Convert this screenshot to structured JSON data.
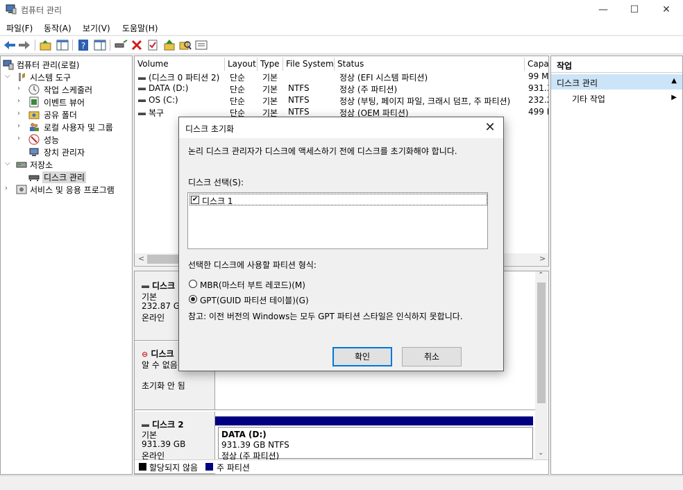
{
  "window": {
    "title": "컴퓨터 관리",
    "minimize": "—",
    "maximize": "☐",
    "close": "✕"
  },
  "menu": [
    "파일(F)",
    "동작(A)",
    "보기(V)",
    "도움말(H)"
  ],
  "tree": {
    "items": [
      {
        "label": "컴퓨터 관리(로컬)",
        "icon": "computer-management-icon"
      },
      {
        "label": "시스템 도구",
        "icon": "tools-icon"
      },
      {
        "label": "작업 스케줄러",
        "icon": "clock-icon"
      },
      {
        "label": "이벤트 뷰어",
        "icon": "event-viewer-icon"
      },
      {
        "label": "공유 폴더",
        "icon": "shared-folder-icon"
      },
      {
        "label": "로컬 사용자 및 그룹",
        "icon": "users-icon"
      },
      {
        "label": "성능",
        "icon": "performance-icon"
      },
      {
        "label": "장치 관리자",
        "icon": "device-manager-icon"
      },
      {
        "label": "저장소",
        "icon": "storage-icon"
      },
      {
        "label": "디스크 관리",
        "icon": "disk-management-icon"
      },
      {
        "label": "서비스 및 응용 프로그램",
        "icon": "services-icon"
      }
    ]
  },
  "volumes": {
    "headers": [
      "Volume",
      "Layout",
      "Type",
      "File System",
      "Status",
      "Capa"
    ],
    "rows": [
      {
        "volume": "(디스크 0 파티션 2)",
        "layout": "단순",
        "type": "기본",
        "fs": "",
        "status": "정상 (EFI 시스템 파티션)",
        "capacity": "99 M"
      },
      {
        "volume": "DATA (D:)",
        "layout": "단순",
        "type": "기본",
        "fs": "NTFS",
        "status": "정상 (주 파티션)",
        "capacity": "931.3"
      },
      {
        "volume": "OS (C:)",
        "layout": "단순",
        "type": "기본",
        "fs": "NTFS",
        "status": "정상 (부팅, 페이지 파일, 크래시 덤프, 주 파티션)",
        "capacity": "232.2"
      },
      {
        "volume": "복구",
        "layout": "단순",
        "type": "기본",
        "fs": "NTFS",
        "status": "정상 (OEM 파티션)",
        "capacity": "499 I"
      }
    ]
  },
  "disks": [
    {
      "name": "디스크",
      "type": "기본",
      "size": "232.87 GB",
      "state": "온라인"
    },
    {
      "name": "디스크",
      "type": "알 수 없음",
      "size": "",
      "state": "초기화 안 됨"
    },
    {
      "name": "디스크 2",
      "type": "기본",
      "size": "931.39 GB",
      "state": "온라인",
      "partition": {
        "name": "DATA  (D:)",
        "size": "931.39 GB NTFS",
        "status": "정상 (주 파티션)"
      }
    }
  ],
  "legend": {
    "unallocated": "할당되지 않음",
    "primary": "주 파티션",
    "unallocated_color": "#000000",
    "primary_color": "#000080"
  },
  "actions": {
    "header": "작업",
    "section": "디스크 관리",
    "more": "기타 작업"
  },
  "dialog": {
    "title": "디스크 초기화",
    "message": "논리 디스크 관리자가 디스크에 액세스하기 전에 디스크를 초기화해야 합니다.",
    "select_label": "디스크 선택(S):",
    "disk_item": "디스크 1",
    "disk_checked": true,
    "partition_label": "선택한 디스크에 사용할 파티션 형식:",
    "mbr": "MBR(마스터 부트 레코드)(M)",
    "gpt": "GPT(GUID 파티션 테이블)(G)",
    "selected_style": "GPT",
    "note": "참고: 이전 버전의 Windows는 모두 GPT 파티션 스타일은 인식하지 못합니다.",
    "ok": "확인",
    "cancel": "취소"
  },
  "colors": {
    "accent": "#0078d7",
    "selection": "#cce4f7",
    "partition_bar": "#000080"
  }
}
